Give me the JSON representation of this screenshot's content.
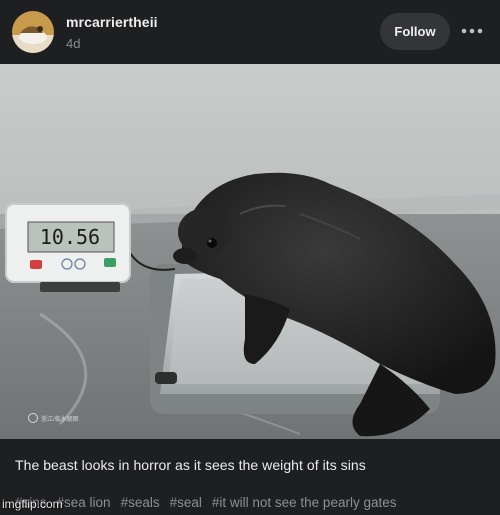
{
  "post": {
    "author": "mrcarriertheii",
    "age": "4d",
    "follow_label": "Follow",
    "more_label": "•••",
    "image": {
      "scale_reading": "10.56",
      "watermark": "浙江/临水朝图"
    },
    "caption": "The beast looks in horror as it sees the weight of its sins",
    "tags": [
      "#sins",
      "#sea lion",
      "#seals",
      "#seal",
      "#it will not see the pearly gates"
    ]
  },
  "overlay": {
    "imgflip_label": "imgflip.com"
  }
}
